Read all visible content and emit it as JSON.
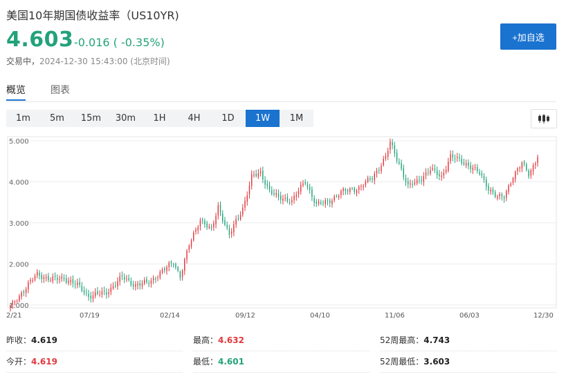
{
  "header": {
    "title": "美国10年期国债收益率（US10YR)",
    "price": "4.603",
    "change": "-0.016 ( -0.35%)",
    "status_label": "交易中，",
    "timestamp": "2024-12-30 15:43:00",
    "timezone": "(北京时间)",
    "watch_button": "+加自选"
  },
  "tabs": [
    {
      "label": "概览",
      "active": true
    },
    {
      "label": "图表",
      "active": false
    }
  ],
  "periods": [
    {
      "label": "1m",
      "active": false
    },
    {
      "label": "5m",
      "active": false
    },
    {
      "label": "15m",
      "active": false
    },
    {
      "label": "30m",
      "active": false
    },
    {
      "label": "1H",
      "active": false
    },
    {
      "label": "4H",
      "active": false
    },
    {
      "label": "1D",
      "active": false
    },
    {
      "label": "1W",
      "active": true
    },
    {
      "label": "1M",
      "active": false
    }
  ],
  "chart_type_icon": "candlestick-icon",
  "chart_data": {
    "type": "candlestick",
    "y_ticks": [
      "5.000",
      "4.000",
      "3.000",
      "2.000",
      "1.000"
    ],
    "ylim": [
      0.93,
      5.1
    ],
    "x_ticks": [
      "2/21",
      "07/19",
      "02/14",
      "09/12",
      "04/10",
      "11/06",
      "06/03",
      "12/30"
    ],
    "grid": true,
    "up_color": "#e0383e",
    "down_color": "#23a27a",
    "keypoints": [
      [
        0,
        0.95
      ],
      [
        8,
        1.5
      ],
      [
        12,
        1.75
      ],
      [
        18,
        1.62
      ],
      [
        24,
        1.65
      ],
      [
        30,
        1.48
      ],
      [
        35,
        1.22
      ],
      [
        43,
        1.3
      ],
      [
        50,
        1.68
      ],
      [
        56,
        1.48
      ],
      [
        62,
        1.55
      ],
      [
        68,
        1.82
      ],
      [
        73,
        2.05
      ],
      [
        76,
        1.7
      ],
      [
        80,
        2.45
      ],
      [
        85,
        3.1
      ],
      [
        90,
        2.8
      ],
      [
        93,
        3.4
      ],
      [
        98,
        2.7
      ],
      [
        104,
        3.35
      ],
      [
        108,
        4.12
      ],
      [
        112,
        4.2
      ],
      [
        116,
        3.8
      ],
      [
        120,
        3.6
      ],
      [
        126,
        3.55
      ],
      [
        132,
        4.0
      ],
      [
        137,
        3.45
      ],
      [
        142,
        3.5
      ],
      [
        148,
        3.75
      ],
      [
        156,
        3.85
      ],
      [
        162,
        4.1
      ],
      [
        168,
        4.6
      ],
      [
        170,
        4.95
      ],
      [
        174,
        4.45
      ],
      [
        178,
        3.88
      ],
      [
        182,
        4.0
      ],
      [
        188,
        4.3
      ],
      [
        193,
        4.12
      ],
      [
        197,
        4.62
      ],
      [
        200,
        4.55
      ],
      [
        206,
        4.38
      ],
      [
        210,
        4.2
      ],
      [
        214,
        3.85
      ],
      [
        218,
        3.62
      ],
      [
        221,
        3.62
      ],
      [
        225,
        4.15
      ],
      [
        229,
        4.45
      ],
      [
        232,
        4.18
      ],
      [
        236,
        4.6
      ]
    ],
    "last_close": 4.603
  },
  "stats": {
    "prev_close_label": "昨收：",
    "prev_close": "4.619",
    "high_label": "最高：",
    "high": "4.632",
    "high52_label": "52周最高：",
    "high52": "4.743",
    "open_label": "今开：",
    "open": "4.619",
    "low_label": "最低：",
    "low": "4.601",
    "low52_label": "52周最低：",
    "low52": "3.603"
  }
}
